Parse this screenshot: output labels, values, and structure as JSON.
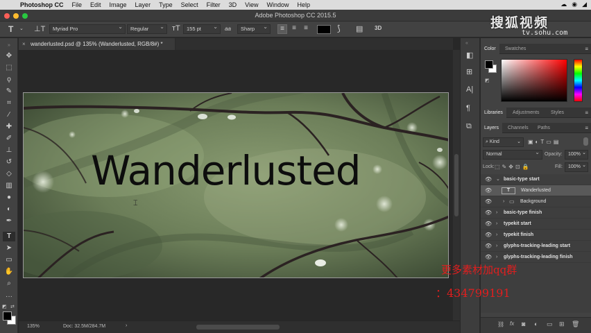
{
  "menubar": {
    "app_name": "Photoshop CC",
    "items": [
      "File",
      "Edit",
      "Image",
      "Layer",
      "Type",
      "Select",
      "Filter",
      "3D",
      "View",
      "Window",
      "Help"
    ]
  },
  "window": {
    "title": "Adobe Photoshop CC 2015.5"
  },
  "options_bar": {
    "font_family": "Myriad Pro",
    "font_style": "Regular",
    "font_size": "155 pt",
    "aa_size_symbol": "aa",
    "anti_alias": "Sharp",
    "text_color": "#000000",
    "mode_3d_label": "3D"
  },
  "document": {
    "tab_title": "wanderlusted.psd @ 135% (Wanderlusted, RGB/8#) *",
    "canvas_text": "Wanderlusted",
    "zoom": "135%",
    "doc_size": "Doc: 32.5M/284.7M"
  },
  "color_panel": {
    "tabs": [
      "Color",
      "Swatches"
    ],
    "foreground": "#000000",
    "background": "#ffffff",
    "hue": "#ff0000"
  },
  "libraries_panel": {
    "tabs": [
      "Libraries",
      "Adjustments",
      "Styles"
    ]
  },
  "layers_panel": {
    "tabs": [
      "Layers",
      "Channels",
      "Paths"
    ],
    "filter_kind": "Kind",
    "blend_mode": "Normal",
    "opacity_label": "Opacity:",
    "opacity_value": "100%",
    "lock_label": "Lock:",
    "fill_label": "Fill:",
    "fill_value": "100%",
    "layers": [
      {
        "name": "basic-type start",
        "type": "group-open"
      },
      {
        "name": "Wanderlusted",
        "type": "text"
      },
      {
        "name": "Background",
        "type": "group-child"
      },
      {
        "name": "basic-type finish",
        "type": "group"
      },
      {
        "name": "typekit start",
        "type": "group"
      },
      {
        "name": "typekit finish",
        "type": "group"
      },
      {
        "name": "glyphs-tracking-leading start",
        "type": "group"
      },
      {
        "name": "glyphs-tracking-leading finish",
        "type": "group"
      }
    ]
  },
  "watermark": {
    "logo_text": "搜狐视频",
    "url_text": "tv.sohu.com",
    "overlay_line1": "更多素材加qq群",
    "overlay_line2": "：434799191"
  }
}
